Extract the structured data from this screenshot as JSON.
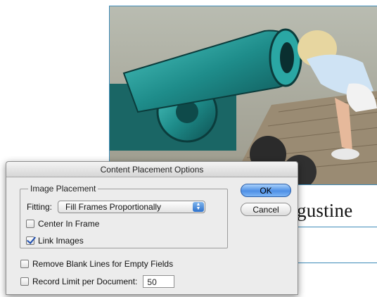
{
  "background": {
    "photo_alt": "child looking into cannon barrel",
    "document_text": "gustine"
  },
  "dialog": {
    "title": "Content Placement Options",
    "image_placement": {
      "legend": "Image Placement",
      "fitting_label": "Fitting:",
      "fitting_value": "Fill Frames Proportionally",
      "center_in_frame": {
        "label": "Center In Frame",
        "checked": false
      },
      "link_images": {
        "label": "Link Images",
        "checked": true
      }
    },
    "remove_blank_lines": {
      "label": "Remove Blank Lines for Empty Fields",
      "checked": false
    },
    "record_limit": {
      "label": "Record Limit per Document:",
      "checked": false,
      "value": "50"
    },
    "ok_label": "OK",
    "cancel_label": "Cancel"
  },
  "colors": {
    "frame_blue": "#3d8bb8",
    "dialog_bg": "#ececec",
    "ok_blue": "#4e8fe5"
  }
}
